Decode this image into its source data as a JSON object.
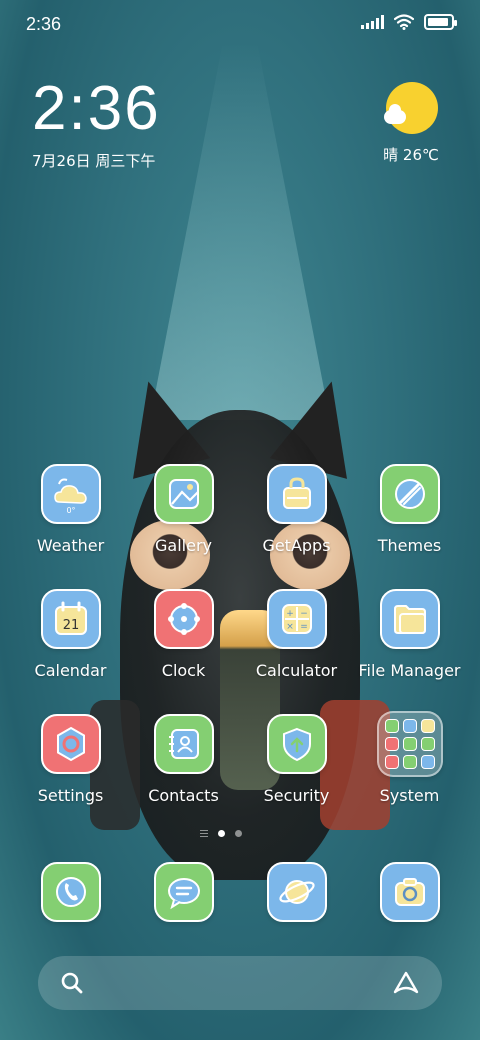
{
  "status_bar": {
    "time": "2:36"
  },
  "clock_widget": {
    "time": "2:36",
    "date": "7月26日 周三下午"
  },
  "weather_widget": {
    "condition": "晴",
    "temperature": "26℃",
    "display": "晴 26℃"
  },
  "apps": [
    [
      {
        "name": "weather",
        "label": "Weather",
        "color": "#7cb7ea"
      },
      {
        "name": "gallery",
        "label": "Gallery",
        "color": "#84cf72"
      },
      {
        "name": "getapps",
        "label": "GetApps",
        "color": "#7cb7ea"
      },
      {
        "name": "themes",
        "label": "Themes",
        "color": "#84cf72"
      }
    ],
    [
      {
        "name": "calendar",
        "label": "Calendar",
        "color": "#7cb7ea",
        "day": "21"
      },
      {
        "name": "clock",
        "label": "Clock",
        "color": "#f07274"
      },
      {
        "name": "calculator",
        "label": "Calculator",
        "color": "#7cb7ea"
      },
      {
        "name": "file-manager",
        "label": "File Manager",
        "color": "#7cb7ea"
      }
    ],
    [
      {
        "name": "settings",
        "label": "Settings",
        "color": "#f07274"
      },
      {
        "name": "contacts",
        "label": "Contacts",
        "color": "#84cf72"
      },
      {
        "name": "security",
        "label": "Security",
        "color": "#84cf72"
      },
      {
        "name": "system-folder",
        "label": "System",
        "color": "folder"
      }
    ]
  ],
  "weather_icon_text": "0°",
  "dock": [
    {
      "name": "phone",
      "icon": "phone-icon",
      "color": "#84cf72"
    },
    {
      "name": "messages",
      "icon": "message-icon",
      "color": "#84cf72"
    },
    {
      "name": "browser",
      "icon": "planet-icon",
      "color": "#7cb7ea"
    },
    {
      "name": "camera",
      "icon": "camera-icon",
      "color": "#7cb7ea"
    }
  ],
  "page_indicator": {
    "pages": 2,
    "current": 1
  },
  "search_bar": {
    "left_icon": "search-icon",
    "right_icon": "assistant-icon"
  },
  "colors": {
    "tile_blue": "#7cb7ea",
    "tile_green": "#84cf72",
    "tile_red": "#f07274",
    "glyph_yellow": "#f6e59a",
    "sun": "#f8d12f"
  }
}
